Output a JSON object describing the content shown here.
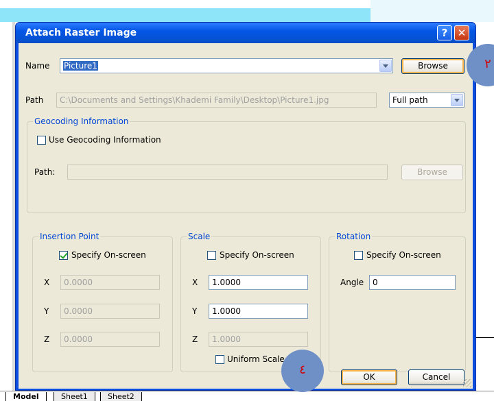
{
  "dialog": {
    "title": "Attach Raster Image",
    "help_symbol": "?",
    "close_symbol": "✕"
  },
  "name_row": {
    "label": "Name",
    "value": "Picture1",
    "browse_label": "Browse"
  },
  "path_row": {
    "label": "Path",
    "value": "C:\\Documents and Settings\\Khademi Family\\Desktop\\Picture1.jpg",
    "path_type": "Full path"
  },
  "geocoding": {
    "title": "Geocoding Information",
    "use_label": "Use Geocoding Information",
    "path_label": "Path:",
    "path_value": "",
    "browse_label": "Browse"
  },
  "insertion": {
    "title": "Insertion Point",
    "specify_label": "Specify On-screen",
    "x_label": "X",
    "x_value": "0.0000",
    "y_label": "Y",
    "y_value": "0.0000",
    "z_label": "Z",
    "z_value": "0.0000"
  },
  "scale": {
    "title": "Scale",
    "specify_label": "Specify On-screen",
    "x_label": "X",
    "x_value": "1.0000",
    "y_label": "Y",
    "y_value": "1.0000",
    "z_label": "Z",
    "z_value": "1.0000",
    "uniform_label": "Uniform Scale"
  },
  "rotation": {
    "title": "Rotation",
    "specify_label": "Specify On-screen",
    "angle_label": "Angle",
    "angle_value": "0"
  },
  "footer": {
    "ok_label": "OK",
    "cancel_label": "Cancel"
  },
  "annotations": {
    "step_2": "٢",
    "step_4": "٤"
  },
  "sheet_tabs": [
    "Model",
    "Sheet1",
    "Sheet2"
  ],
  "colors": {
    "title_bar": "#0456e5",
    "dialog_bg": "#ece9d8",
    "group_title": "#0046d5",
    "annotation_circle": "#6f8fc7",
    "annotation_text": "#d10000",
    "background_accent": "#8ee5f9"
  }
}
